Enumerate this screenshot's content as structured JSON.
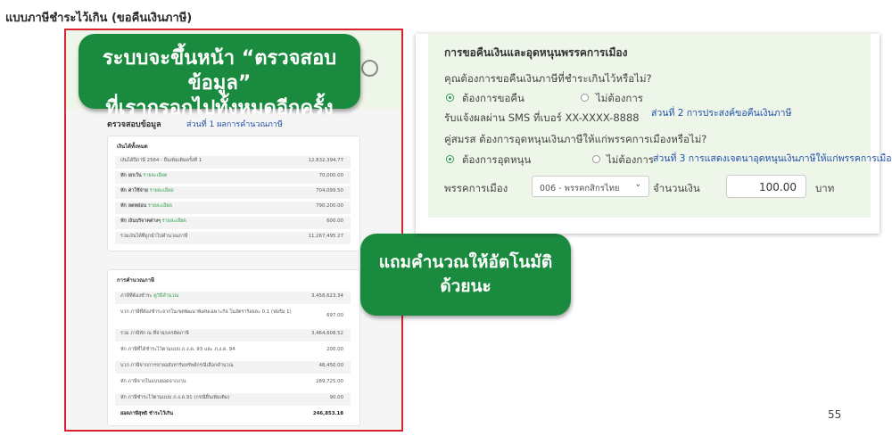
{
  "slide": {
    "title": "แบบภาษีชำระไว้เกิน (ขอคืนเงินภาษี)",
    "page_number": "55"
  },
  "callouts": {
    "review_line1": "ระบบจะขึ้นหน้า “ตรวจสอบข้อมูล”",
    "review_line2": "ที่เรากรอกไปทั้งหมดอีกครั้ง",
    "auto_line1": "แถมคำนวณให้อัตโนมัติ",
    "auto_line2": "ด้วยนะ"
  },
  "review_panel": {
    "title": "ตรวจสอบข้อมูล",
    "part_link": "ส่วนที่ 1 ผลการคำนวณภาษี",
    "income_card": {
      "heading": "เงินได้ทั้งหมด",
      "rows": [
        {
          "label": "เงินได้ปีภาษี 2564 - ยื่นเพิ่มเติมครั้งที่ 1",
          "tag": "",
          "amount": "12,832,394.77"
        },
        {
          "label": "หัก ยกเว้น",
          "tag": "รายละเอียด",
          "amount": "70,000.00"
        },
        {
          "label": "หัก ค่าใช้จ่าย",
          "tag": "รายละเอียด",
          "amount": "704,099.50"
        },
        {
          "label": "หัก ลดหย่อน",
          "tag": "รายละเอียด",
          "amount": "790,200.00"
        },
        {
          "label": "หัก เงินบริจาคต่างๆ",
          "tag": "รายละเอียด",
          "amount": "600.00"
        },
        {
          "label": "รวมเงินได้ที่ถูกนำไปคำนวณภาษี",
          "tag": "",
          "amount": "11,267,495.27"
        }
      ]
    },
    "tax_card": {
      "heading": "การคำนวณภาษี",
      "rows": [
        {
          "label": "ภาษีที่ต้องชำระ",
          "tag": "ดูวิธีคำนวณ",
          "amount": "3,458,623.34"
        },
        {
          "label": "บวก ภาษีที่ต้องชำระจากในเขตพัฒนาพิเศษเฉพาะกิจ ในอัตราร้อยละ 0.1 (ฟอร์ม 1)",
          "tag": "",
          "amount": "697.00"
        },
        {
          "label": "รวม ภาษีหัก ณ ที่จ่าย/เครดิตภาษี",
          "tag": "",
          "amount": "3,464,608.52"
        },
        {
          "label": "หัก ภาษีที่ได้ชำระไว้ตามแบบ ภ.ง.ด. 93 และ ภ.ง.ด. 94",
          "tag": "",
          "amount": "200.00"
        },
        {
          "label": "บวก ภาษีจากการขายอสังหาริมทรัพย์กรณีเลือกคำนวณ",
          "tag": "",
          "amount": "48,450.00"
        },
        {
          "label": "หัก ภาษีจากในแบบยอดจากงาน",
          "tag": "",
          "amount": "289,725.00"
        },
        {
          "label": "หัก ภาษีชำระไว้ตามแบบ ภ.ง.ด.91 (กรณียื่นเพิ่มเติม)",
          "tag": "",
          "amount": "90.00"
        },
        {
          "label": "ยอดภาษีสุทธิ ชำระไว้เกิน",
          "tag": "",
          "amount": "246,853.18"
        }
      ]
    }
  },
  "refund_panel": {
    "title": "การขอคืนเงินและอุดหนุนพรรคการเมือง",
    "refund_question": "คุณต้องการขอคืนเงินภาษีที่ชำระเกินไว้หรือไม่?",
    "refund_yes": "ต้องการขอคืน",
    "refund_no": "ไม่ต้องการ",
    "sms_note": "รับแจ้งผลผ่าน SMS ที่เบอร์ XX-XXXX-8888",
    "part2_link": "ส่วนที่ 2 การประสงค์ขอคืนเงินภาษี",
    "party_question": "คู่สมรส ต้องการอุดหนุนเงินภาษีให้แก่พรรคการเมืองหรือไม่?",
    "party_yes": "ต้องการอุดหนุน",
    "party_no": "ไม่ต้องการ",
    "part3_link": "ส่วนที่ 3 การแสดงเจตนาอุดหนุนเงินภาษีให้แก่พรรคการเมือง",
    "party_label": "พรรคการเมือง",
    "party_selected": "006 - พรรคกสิกรไทย",
    "amount_label": "จำนวนเงิน",
    "amount_value": "100.00",
    "currency": "บาท"
  }
}
